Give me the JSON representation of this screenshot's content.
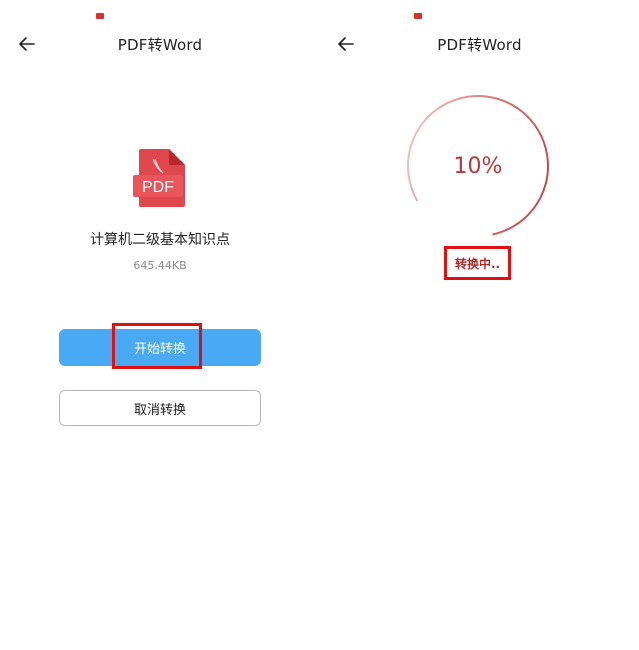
{
  "left_screen": {
    "title": "PDF转Word",
    "file": {
      "icon": "pdf-file-icon",
      "icon_label": "PDF",
      "name": "计算机二级基本知识点",
      "size": "645.44KB"
    },
    "start_button_label": "开始转换",
    "cancel_button_label": "取消转换"
  },
  "right_screen": {
    "title": "PDF转Word",
    "progress": {
      "value": 0.1,
      "text": "10%"
    },
    "status_text": "转换中.."
  },
  "colors": {
    "accent_blue": "#4aa9f4",
    "highlight_red": "#e01010",
    "progress_red": "#c0504d",
    "pdf_red": "#e0474c"
  },
  "icons": {
    "back": "back-arrow-icon",
    "status": "notification-icon"
  }
}
